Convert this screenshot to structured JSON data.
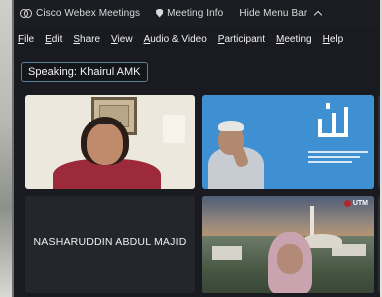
{
  "titlebar": {
    "app_name": "Cisco Webex Meetings",
    "meeting_info": "Meeting Info",
    "hide_menu": "Hide Menu Bar"
  },
  "menu": [
    "File",
    "Edit",
    "Share",
    "View",
    "Audio & Video",
    "Participant",
    "Meeting",
    "Help"
  ],
  "speaking": {
    "label": "Speaking: Khairul AMK"
  },
  "tiles": [
    {
      "type": "video"
    },
    {
      "type": "video"
    },
    {
      "type": "name",
      "name": "NASHARUDDIN ABDUL MAJID"
    },
    {
      "type": "video",
      "badge": "UTM"
    }
  ],
  "colors": {
    "titlebar_bg": "#1c1d22",
    "speaking_border": "#5b7c9b",
    "tile2_bg": "#3f8fd3"
  }
}
